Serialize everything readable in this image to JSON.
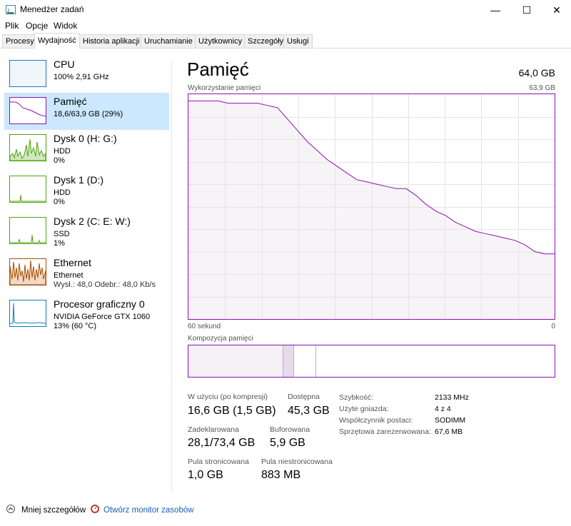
{
  "window": {
    "title": "Menedżer zadań",
    "controls": {
      "minimize": "—",
      "maximize": "☐",
      "close": "✕"
    }
  },
  "menu": [
    "Plik",
    "Opcje",
    "Widok"
  ],
  "tabs": [
    "Procesy",
    "Wydajność",
    "Historia aplikacji",
    "Uruchamianie",
    "Użytkownicy",
    "Szczegóły",
    "Usługi"
  ],
  "active_tab": "Wydajność",
  "sidebar": {
    "items": [
      {
        "name": "CPU",
        "lines": [
          "100% 2,91 GHz"
        ],
        "color": "#117dbb",
        "selected": false
      },
      {
        "name": "Pamięć",
        "lines": [
          "18,6/63,9 GB (29%)"
        ],
        "color": "#8b12ae",
        "selected": true
      },
      {
        "name": "Dysk 0 (H: G:)",
        "lines": [
          "HDD",
          "0%"
        ],
        "color": "#4da60c",
        "selected": false
      },
      {
        "name": "Dysk 1 (D:)",
        "lines": [
          "HDD",
          "0%"
        ],
        "color": "#4da60c",
        "selected": false
      },
      {
        "name": "Dysk 2 (C: E: W:)",
        "lines": [
          "SSD",
          "1%"
        ],
        "color": "#4da60c",
        "selected": false
      },
      {
        "name": "Ethernet",
        "lines": [
          "Ethernet",
          "Wysł.: 48,0  Odebr.: 48,0 Kb/s"
        ],
        "color": "#a74f01",
        "selected": false
      },
      {
        "name": "Procesor graficzny 0",
        "lines": [
          "NVIDIA GeForce GTX 1060",
          "13% (60 °C)"
        ],
        "color": "#117dbb",
        "selected": false
      }
    ]
  },
  "main": {
    "title": "Pamięć",
    "total": "64,0 GB",
    "usage_label": "Wykorzystanie pamięci",
    "usage_max": "63,9 GB",
    "time_left": "60 sekund",
    "time_right": "0",
    "composition_label": "Kompozycja pamięci",
    "colors": {
      "line": "#8b12ae",
      "fill": "#f4f2f4",
      "grid": "#e8e1ea"
    },
    "usage_history": [
      0.97,
      0.97,
      0.97,
      0.97,
      0.96,
      0.96,
      0.96,
      0.96,
      0.95,
      0.94,
      0.89,
      0.84,
      0.79,
      0.75,
      0.71,
      0.68,
      0.65,
      0.62,
      0.61,
      0.6,
      0.59,
      0.58,
      0.58,
      0.55,
      0.51,
      0.48,
      0.46,
      0.43,
      0.41,
      0.39,
      0.38,
      0.37,
      0.36,
      0.35,
      0.33,
      0.3,
      0.29,
      0.29
    ],
    "composition": {
      "in_use": 0.26,
      "modified": 0.03,
      "standby": 0.06
    },
    "stats": {
      "in_use_label": "W użyciu (po kompresji)",
      "in_use_value": "16,6 GB (1,5 GB)",
      "available_label": "Dostępna",
      "available_value": "45,3 GB",
      "committed_label": "Zadeklarowana",
      "committed_value": "28,1/73,4 GB",
      "cached_label": "Buforowana",
      "cached_value": "5,9 GB",
      "paged_label": "Pula stronicowana",
      "paged_value": "1,0 GB",
      "nonpaged_label": "Pula niestronicowana",
      "nonpaged_value": "883 MB"
    },
    "details": [
      {
        "label": "Szybkość:",
        "value": "2133 MHz"
      },
      {
        "label": "Użyte gniazda:",
        "value": "4 z 4"
      },
      {
        "label": "Współczynnik postaci:",
        "value": "SODIMM"
      },
      {
        "label": "Sprzętowa zarezerwowana:",
        "value": "67,6 MB"
      }
    ]
  },
  "footer": {
    "less_details": "Mniej szczegółów",
    "open_monitor": "Otwórz monitor zasobów"
  }
}
